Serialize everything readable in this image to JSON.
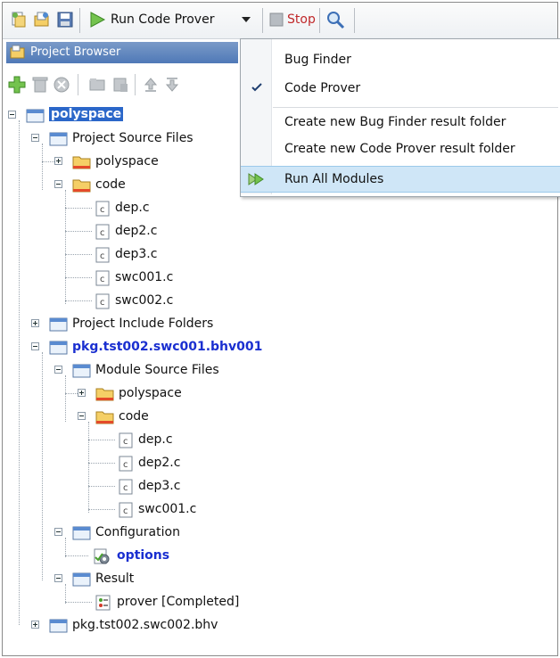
{
  "toolbar": {
    "run_label": "Run Code Prover",
    "stop_label": "Stop"
  },
  "project_browser": {
    "title": "Project Browser"
  },
  "menu": {
    "items": [
      {
        "label": "Bug Finder"
      },
      {
        "label": "Code Prover",
        "checked": true
      },
      {
        "label": "Create new Bug Finder result folder"
      },
      {
        "label": "Create new Code Prover result folder"
      },
      {
        "label": "Run All Modules",
        "highlighted": true
      }
    ]
  },
  "tree": {
    "rows": [
      {
        "label": "polyspace"
      },
      {
        "label": "Project Source Files"
      },
      {
        "label": "polyspace"
      },
      {
        "label": "code"
      },
      {
        "label": "dep.c"
      },
      {
        "label": "dep2.c"
      },
      {
        "label": "dep3.c"
      },
      {
        "label": "swc001.c"
      },
      {
        "label": "swc002.c"
      },
      {
        "label": "Project Include Folders"
      },
      {
        "label": "pkg.tst002.swc001.bhv001"
      },
      {
        "label": "Module Source Files"
      },
      {
        "label": "polyspace"
      },
      {
        "label": "code"
      },
      {
        "label": "dep.c"
      },
      {
        "label": "dep2.c"
      },
      {
        "label": "dep3.c"
      },
      {
        "label": "swc001.c"
      },
      {
        "label": "Configuration"
      },
      {
        "label": "options"
      },
      {
        "label": "Result"
      },
      {
        "label": "prover [Completed]"
      },
      {
        "label": "pkg.tst002.swc002.bhv"
      }
    ]
  }
}
